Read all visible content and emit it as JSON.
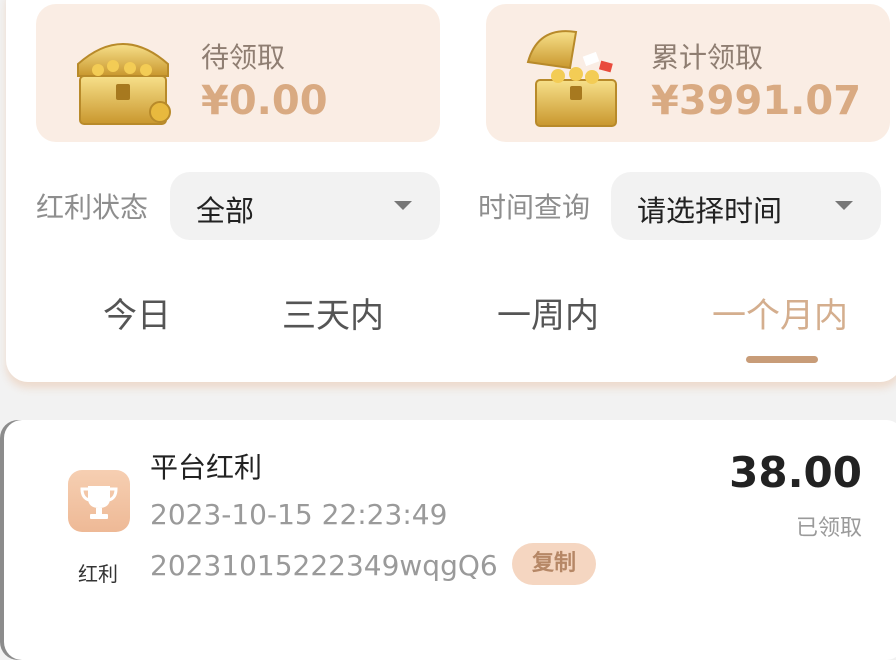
{
  "summary": {
    "pending": {
      "label": "待领取",
      "value": "¥0.00",
      "icon": "treasure-chest-icon"
    },
    "total": {
      "label": "累计领取",
      "value": "¥3991.07",
      "icon": "open-treasure-chest-icon"
    }
  },
  "filters": {
    "status": {
      "label": "红利状态",
      "value": "全部"
    },
    "time": {
      "label": "时间查询",
      "value": "请选择时间"
    }
  },
  "tabs": [
    {
      "label": "今日"
    },
    {
      "label": "三天内"
    },
    {
      "label": "一周内"
    },
    {
      "label": "一个月内",
      "active": true
    }
  ],
  "records": [
    {
      "title": "平台红利",
      "time": "2023-10-15 22:23:49",
      "id": "20231015222349wqgQ6",
      "copy_label": "复制",
      "amount": "38.00",
      "status": "已领取",
      "icon_label": "红利",
      "icon": "trophy-icon"
    }
  ],
  "colors": {
    "accent": "#d4ae8e",
    "card_bg": "#faede4",
    "value_text": "#d9aa82",
    "copy_bg": "#f5d6c1"
  }
}
